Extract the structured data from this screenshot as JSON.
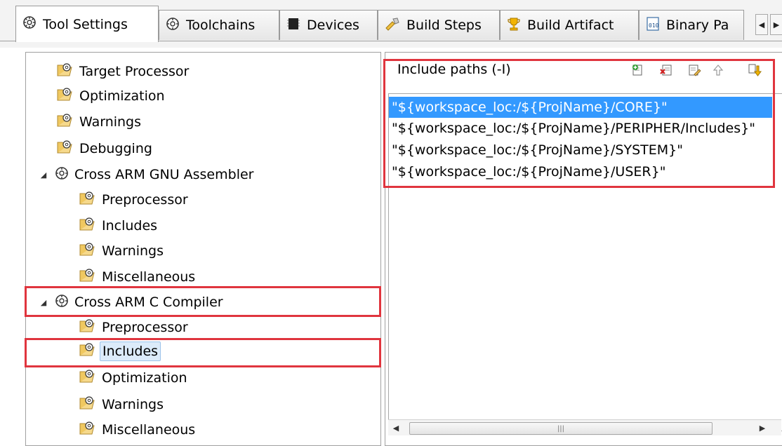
{
  "tabs": [
    {
      "label": "Tool Settings",
      "icon": "gear-icon",
      "active": true
    },
    {
      "label": "Toolchains",
      "icon": "gear-icon"
    },
    {
      "label": "Devices",
      "icon": "chip-icon"
    },
    {
      "label": "Build Steps",
      "icon": "build-steps-icon"
    },
    {
      "label": "Build Artifact",
      "icon": "trophy-icon"
    },
    {
      "label": "Binary Pa",
      "icon": "binary-icon"
    }
  ],
  "tab_scroll": {
    "left_icon": "chevron-left-icon",
    "right_icon": "chevron-right-icon"
  },
  "tree": {
    "items": [
      {
        "label": "Target Processor",
        "level": 1
      },
      {
        "label": "Optimization",
        "level": 1
      },
      {
        "label": "Warnings",
        "level": 1
      },
      {
        "label": "Debugging",
        "level": 1
      },
      {
        "label": "Cross ARM GNU Assembler",
        "level": 0,
        "expanded": true
      },
      {
        "label": "Preprocessor",
        "level": 1
      },
      {
        "label": "Includes",
        "level": 1
      },
      {
        "label": "Warnings",
        "level": 1
      },
      {
        "label": "Miscellaneous",
        "level": 1
      },
      {
        "label": "Cross ARM C Compiler",
        "level": 0,
        "expanded": true,
        "highlighted": true
      },
      {
        "label": "Preprocessor",
        "level": 1
      },
      {
        "label": "Includes",
        "level": 1,
        "selected": true,
        "highlighted": true
      },
      {
        "label": "Optimization",
        "level": 1
      },
      {
        "label": "Warnings",
        "level": 1
      },
      {
        "label": "Miscellaneous",
        "level": 1
      }
    ]
  },
  "include_paths": {
    "title": "Include paths (-I)",
    "toolbar": [
      "add-icon",
      "delete-icon",
      "edit-icon",
      "move-up-icon",
      "move-down-icon"
    ],
    "items": [
      {
        "value": "\"${workspace_loc:/${ProjName}/CORE}\"",
        "selected": true
      },
      {
        "value": "\"${workspace_loc:/${ProjName}/PERIPHER/Includes}\""
      },
      {
        "value": "\"${workspace_loc:/${ProjName}/SYSTEM}\""
      },
      {
        "value": "\"${workspace_loc:/${ProjName}/USER}\""
      }
    ]
  },
  "colors": {
    "highlight_box": "#e0353e",
    "selection": "#3399ff"
  }
}
